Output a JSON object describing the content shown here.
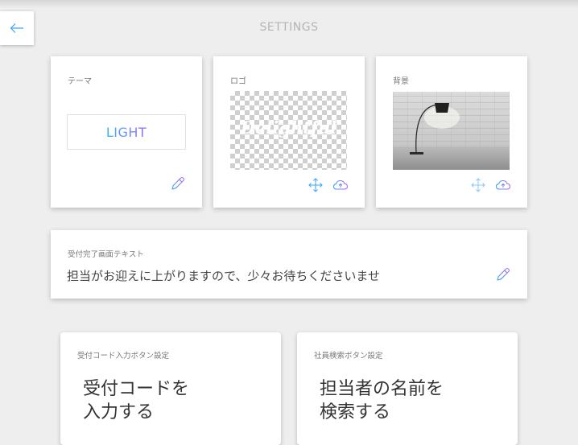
{
  "header": {
    "title": "SETTINGS",
    "back_icon": "arrow-left-icon"
  },
  "theme_card": {
    "label": "テーマ",
    "value": "LIGHT",
    "edit_icon": "pencil-icon"
  },
  "logo_card": {
    "label": "ロゴ",
    "logo_text": "Delightful",
    "move_icon": "move-arrows-icon",
    "upload_icon": "cloud-upload-icon"
  },
  "background_card": {
    "label": "背景",
    "move_icon": "move-arrows-icon",
    "upload_icon": "cloud-upload-icon"
  },
  "completion_text_card": {
    "label": "受付完了画面テキスト",
    "text": "担当がお迎えに上がりますので、少々お待ちくださいませ",
    "edit_icon": "pencil-icon"
  },
  "reception_code_button_card": {
    "label": "受付コード入力ボタン設定",
    "text": "受付コードを\n入力する"
  },
  "employee_search_button_card": {
    "label": "社員検索ボタン設定",
    "text": "担当者の名前を\n検索する"
  },
  "colors": {
    "background": "#eeeeee",
    "accent_blue": "#3ea5f2",
    "accent_purple": "#b06cf0"
  }
}
